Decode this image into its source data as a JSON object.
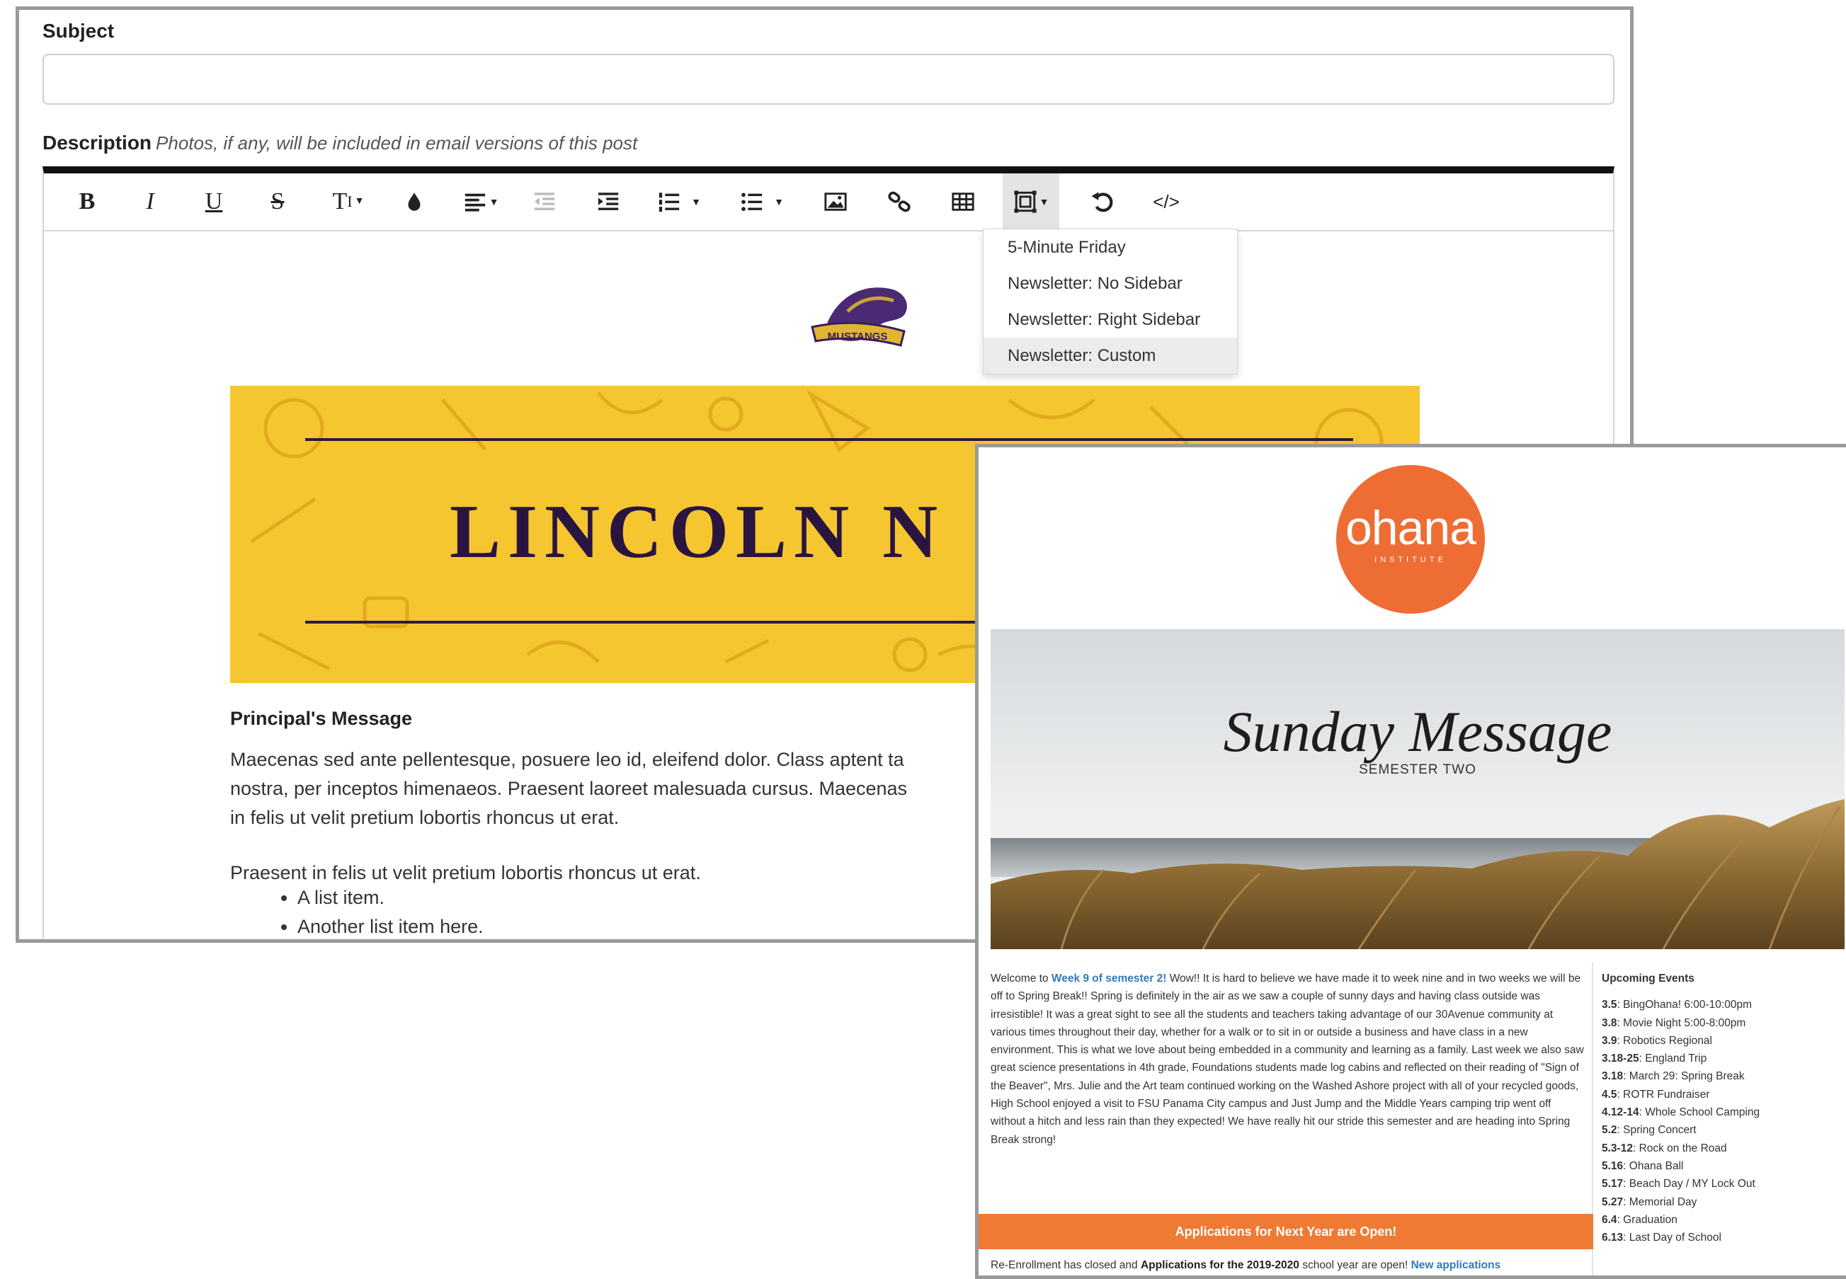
{
  "editor": {
    "subject_label": "Subject",
    "subject_value": "",
    "description_label": "Description",
    "description_hint": "Photos, if any, will be included in email versions of this post",
    "toolbar": [
      {
        "name": "bold-button",
        "glyph": "B"
      },
      {
        "name": "italic-button",
        "glyph": "I"
      },
      {
        "name": "underline-button",
        "glyph": "U"
      },
      {
        "name": "strikethrough-button",
        "glyph": "S"
      },
      {
        "name": "font-size-button",
        "glyph": "T↕"
      },
      {
        "name": "text-color-button",
        "glyph": "💧"
      },
      {
        "name": "align-button",
        "glyph": "≡"
      },
      {
        "name": "outdent-button",
        "glyph": ""
      },
      {
        "name": "indent-button",
        "glyph": ""
      },
      {
        "name": "ordered-list-button",
        "glyph": ""
      },
      {
        "name": "unordered-list-button",
        "glyph": ""
      },
      {
        "name": "insert-image-button",
        "glyph": ""
      },
      {
        "name": "insert-link-button",
        "glyph": ""
      },
      {
        "name": "insert-table-button",
        "glyph": ""
      },
      {
        "name": "template-button",
        "glyph": ""
      },
      {
        "name": "undo-button",
        "glyph": "↺"
      },
      {
        "name": "code-view-button",
        "glyph": "</>"
      }
    ],
    "template_menu": [
      "5-Minute Friday",
      "Newsletter: No Sidebar",
      "Newsletter: Right Sidebar",
      "Newsletter: Custom"
    ],
    "content": {
      "logo_text": "MUSTANGS",
      "banner_title": "LINCOLN N",
      "principal_heading": "Principal's Message",
      "para1_line1": "Maecenas sed ante pellentesque, posuere leo id, eleifend dolor. Class aptent ta",
      "para1_line2": "nostra, per inceptos himenaeos. Praesent laoreet malesuada cursus. Maecenas",
      "para1_line3": "in felis ut velit pretium lobortis rhoncus ut erat.",
      "para2": "Praesent in felis ut velit pretium lobortis rhoncus ut erat.",
      "list_items": [
        "A list item.",
        "Another list item here."
      ]
    }
  },
  "preview": {
    "logo_name": "ohana",
    "logo_sub": "INSTITUTE",
    "hero_title": "Sunday Message",
    "hero_sub": "SEMESTER TWO",
    "welcome_prefix": "Welcome to ",
    "welcome_highlight": "Week 9 of semester 2!",
    "welcome_body": " Wow!! It is hard to believe we have made it to week nine and in two weeks we will be off to Spring Break!! Spring is definitely in the air as we saw a couple of sunny days and having class outside was irresistible! It was a great sight to see all the students and teachers taking advantage of our 30Avenue community at various times throughout their day, whether for a walk or to sit in or outside a business and have class in a new environment. This is what we love about being embedded in a community and learning as a family. Last week we also saw great science presentations in 4th grade, Foundations students made log cabins and reflected on their reading of \"Sign of the Beaver\", Mrs. Julie and the Art team continued working on the Washed Ashore project with all of your recycled goods, High School enjoyed a visit to FSU Panama City campus and Just Jump and the Middle Years camping trip went off without a hitch and less rain than they expected! We have really hit our stride this semester and are heading into Spring Break strong!",
    "events_title": "Upcoming Events",
    "events": [
      {
        "date": "3.5",
        "text": ": BingOhana! 6:00-10:00pm"
      },
      {
        "date": "3.8",
        "text": ": Movie Night 5:00-8:00pm"
      },
      {
        "date": "3.9",
        "text": ": Robotics Regional"
      },
      {
        "date": "3.18-25",
        "text": ": England Trip"
      },
      {
        "date": "3.18",
        "text": ": March 29: Spring Break"
      },
      {
        "date": "4.5",
        "text": ": ROTR Fundraiser"
      },
      {
        "date": "4.12-14",
        "text": ": Whole School Camping"
      },
      {
        "date": "5.2",
        "text": ": Spring Concert"
      },
      {
        "date": "5.3-12",
        "text": ": Rock on the Road"
      },
      {
        "date": "5.16",
        "text": ": Ohana Ball"
      },
      {
        "date": "5.17",
        "text": ": Beach Day / MY Lock Out"
      },
      {
        "date": "5.27",
        "text": ": Memorial Day"
      },
      {
        "date": "6.4",
        "text": ": Graduation"
      },
      {
        "date": "6.13",
        "text": ": Last Day of School"
      }
    ],
    "apps_bar": "Applications for Next Year are Open!",
    "apps_text_1": "Re-Enrollment has closed and ",
    "apps_text_bold": "Applications for the 2019-2020",
    "apps_text_2": " school year are open! ",
    "apps_text_link": "New applications"
  }
}
